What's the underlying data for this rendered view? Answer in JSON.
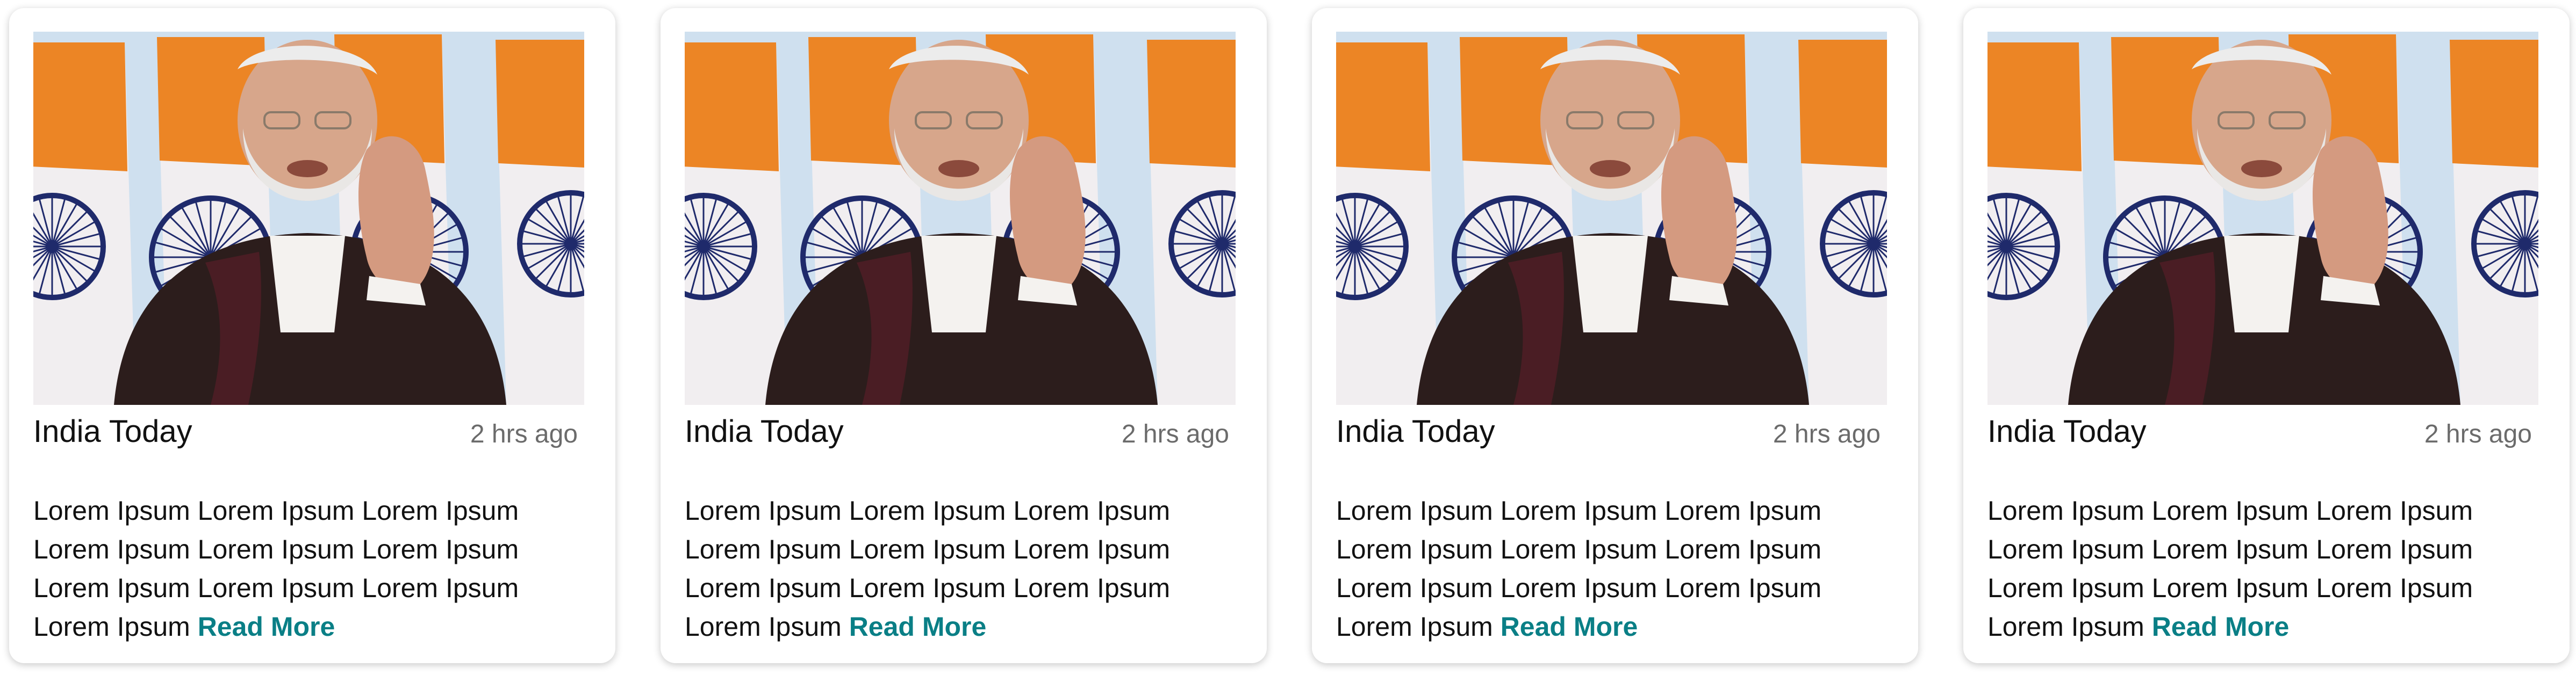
{
  "cards": [
    {
      "source": "India Today",
      "time": "2 hrs ago",
      "text": "Lorem Ipsum Lorem Ipsum Lorem Ipsum Lorem Ipsum Lorem Ipsum Lorem Ipsum Lorem Ipsum Lorem Ipsum Lorem Ipsum Lorem Ipsum",
      "read_more": "Read More",
      "image": "news-photo"
    },
    {
      "source": "India Today",
      "time": "2 hrs ago",
      "text": "Lorem Ipsum Lorem Ipsum Lorem Ipsum Lorem Ipsum Lorem Ipsum Lorem Ipsum Lorem Ipsum Lorem Ipsum Lorem Ipsum Lorem Ipsum",
      "read_more": "Read More",
      "image": "news-photo"
    },
    {
      "source": "India Today",
      "time": "2 hrs ago",
      "text": "Lorem Ipsum Lorem Ipsum Lorem Ipsum Lorem Ipsum Lorem Ipsum Lorem Ipsum Lorem Ipsum Lorem Ipsum Lorem Ipsum Lorem Ipsum",
      "read_more": "Read More",
      "image": "news-photo"
    },
    {
      "source": "India Today",
      "time": "2 hrs ago",
      "text": "Lorem Ipsum Lorem Ipsum Lorem Ipsum Lorem Ipsum Lorem Ipsum Lorem Ipsum Lorem Ipsum Lorem Ipsum Lorem Ipsum Lorem Ipsum",
      "read_more": "Read More",
      "image": "news-photo"
    }
  ],
  "colors": {
    "link": "#0a7f86",
    "time": "#6b6b6b",
    "text": "#111111"
  }
}
